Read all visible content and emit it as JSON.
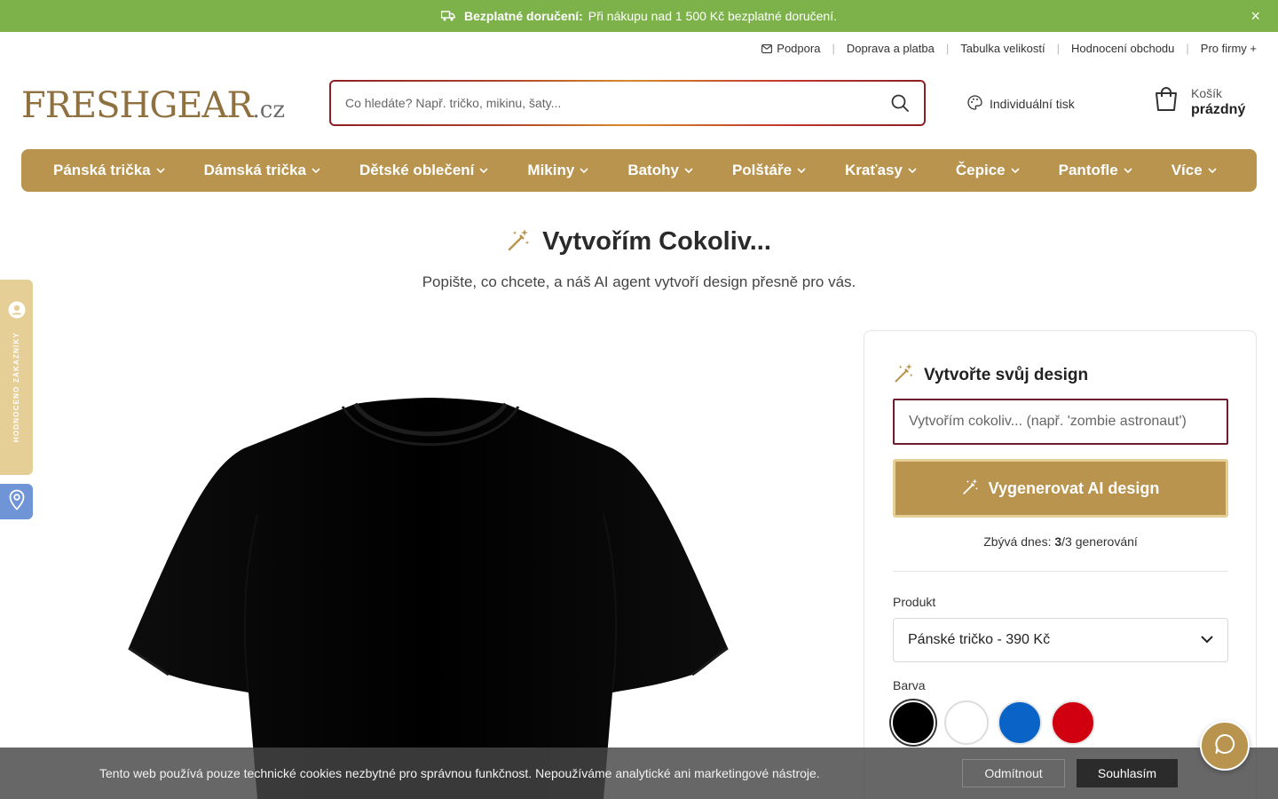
{
  "promo": {
    "bold": "Bezplatné doručení:",
    "text": "Při nákupu nad 1 500 Kč bezplatné doručení.",
    "close": "×",
    "background": "#7db24a"
  },
  "toplinks": {
    "support": "Podpora",
    "shipping": "Doprava a platba",
    "sizes": "Tabulka velikostí",
    "rating": "Hodnocení obchodu",
    "business": "Pro firmy +"
  },
  "header": {
    "logo_main": "FRESHGEAR",
    "logo_tld": ".cz",
    "search_placeholder": "Co hledáte? Např. tričko, mikinu, šaty...",
    "custom_print": "Individuální tisk",
    "cart_label": "Košík",
    "cart_status": "prázdný"
  },
  "nav": {
    "accent": "#b8944e",
    "items": [
      {
        "label": "Pánská trička"
      },
      {
        "label": "Dámská trička"
      },
      {
        "label": "Dětské oblečení"
      },
      {
        "label": "Mikiny"
      },
      {
        "label": "Batohy"
      },
      {
        "label": "Polštáře"
      },
      {
        "label": "Kraťasy"
      },
      {
        "label": "Čepice"
      },
      {
        "label": "Pantofle"
      },
      {
        "label": "Více"
      }
    ]
  },
  "hero": {
    "title": "Vytvořím Cokoliv...",
    "subtitle": "Popište, co chcete, a náš AI agent vytvoří design přesně pro vás."
  },
  "side_tabs": {
    "reviews": "HODNOCENO ZÁKAZNÍKY"
  },
  "panel": {
    "title": "Vytvořte svůj design",
    "prompt_placeholder": "Vytvořím cokoliv... (např. 'zombie astronaut')",
    "generate_button": "Vygenerovat AI design",
    "remaining_prefix": "Zbývá dnes: ",
    "remaining_count": "3",
    "remaining_suffix": "/3 generování",
    "product_label": "Produkt",
    "product_value": "Pánské tričko - 390 Kč",
    "color_label": "Barva",
    "colors": [
      "#000000",
      "#ffffff",
      "#0a64c8",
      "#d00010"
    ],
    "selected_color": "#000000"
  },
  "cookie": {
    "text": "Tento web používá pouze technické cookies nezbytné pro správnou funkčnost. Nepoužíváme analytické ani marketingové nástroje.",
    "decline": "Odmítnout",
    "accept": "Souhlasím"
  }
}
